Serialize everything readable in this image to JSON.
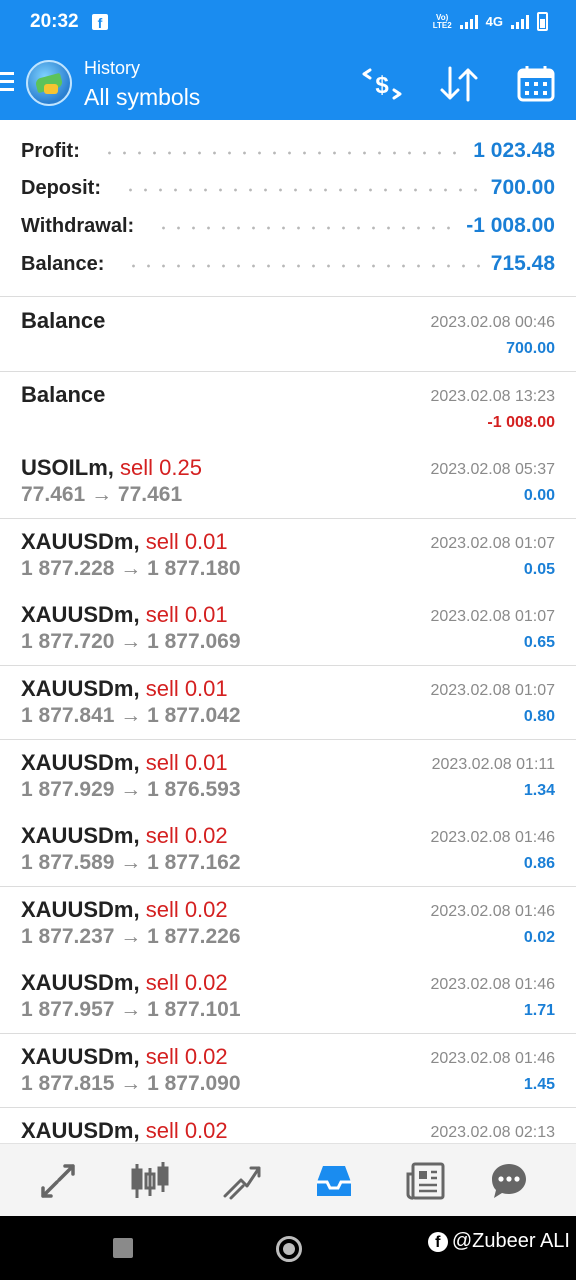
{
  "status_bar": {
    "time": "20:32",
    "network_label": "4G",
    "volte_label": "VoLTE"
  },
  "header": {
    "title": "History",
    "subtitle": "All symbols",
    "background": "#1a8cf0",
    "icons": [
      "menu-icon",
      "app-logo",
      "currency-filter-icon",
      "sort-icon",
      "calendar-icon"
    ]
  },
  "summary": {
    "rows": [
      {
        "label": "Profit:",
        "value": "1 023.48"
      },
      {
        "label": "Deposit:",
        "value": "700.00"
      },
      {
        "label": "Withdrawal:",
        "value": "-1 008.00"
      },
      {
        "label": "Balance:",
        "value": "715.48"
      }
    ]
  },
  "deals": [
    {
      "symbol": "Balance",
      "side": "",
      "prices": "",
      "datetime": "2023.02.08 00:46",
      "profit": "700.00",
      "negative": false
    },
    {
      "symbol": "Balance",
      "side": "",
      "prices": "",
      "datetime": "2023.02.08 13:23",
      "profit": "-1 008.00",
      "negative": true
    },
    {
      "symbol": "USOILm,",
      "side": "sell 0.25",
      "prices": "77.461 → 77.461",
      "datetime": "2023.02.08 05:37",
      "profit": "0.00",
      "negative": false
    },
    {
      "symbol": "XAUUSDm,",
      "side": "sell 0.01",
      "prices": "1 877.228 → 1 877.180",
      "datetime": "2023.02.08 01:07",
      "profit": "0.05",
      "negative": false
    },
    {
      "symbol": "XAUUSDm,",
      "side": "sell 0.01",
      "prices": "1 877.720 → 1 877.069",
      "datetime": "2023.02.08 01:07",
      "profit": "0.65",
      "negative": false
    },
    {
      "symbol": "XAUUSDm,",
      "side": "sell 0.01",
      "prices": "1 877.841 → 1 877.042",
      "datetime": "2023.02.08 01:07",
      "profit": "0.80",
      "negative": false
    },
    {
      "symbol": "XAUUSDm,",
      "side": "sell 0.01",
      "prices": "1 877.929 → 1 876.593",
      "datetime": "2023.02.08 01:11",
      "profit": "1.34",
      "negative": false
    },
    {
      "symbol": "XAUUSDm,",
      "side": "sell 0.02",
      "prices": "1 877.589 → 1 877.162",
      "datetime": "2023.02.08 01:46",
      "profit": "0.86",
      "negative": false
    },
    {
      "symbol": "XAUUSDm,",
      "side": "sell 0.02",
      "prices": "1 877.237 → 1 877.226",
      "datetime": "2023.02.08 01:46",
      "profit": "0.02",
      "negative": false
    },
    {
      "symbol": "XAUUSDm,",
      "side": "sell 0.02",
      "prices": "1 877.957 → 1 877.101",
      "datetime": "2023.02.08 01:46",
      "profit": "1.71",
      "negative": false
    },
    {
      "symbol": "XAUUSDm,",
      "side": "sell 0.02",
      "prices": "1 877.815 → 1 877.090",
      "datetime": "2023.02.08 01:46",
      "profit": "1.45",
      "negative": false
    },
    {
      "symbol": "XAUUSDm,",
      "side": "sell 0.02",
      "prices": "",
      "datetime": "2023.02.08 02:13",
      "profit": "",
      "negative": false
    }
  ],
  "tabs": [
    {
      "name": "tab-quotes",
      "icon": "quotes-arrows-icon",
      "active": false
    },
    {
      "name": "tab-chart",
      "icon": "candlestick-icon",
      "active": false
    },
    {
      "name": "tab-trade",
      "icon": "trade-trend-icon",
      "active": false
    },
    {
      "name": "tab-history",
      "icon": "inbox-icon",
      "active": true
    },
    {
      "name": "tab-news",
      "icon": "newspaper-icon",
      "active": false
    },
    {
      "name": "tab-chat",
      "icon": "chat-bubble-icon",
      "active": false
    }
  ],
  "watermark": {
    "text": "@Zubeer ALI"
  },
  "colors": {
    "accent": "#1a8cf0",
    "positive": "#1a7fd6",
    "negative": "#d42020",
    "sell": "#d42020",
    "muted": "#8a8a8a"
  }
}
